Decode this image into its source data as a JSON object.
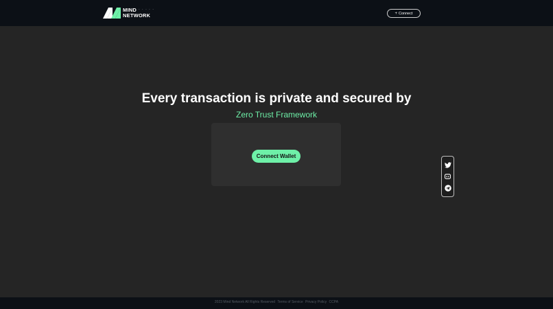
{
  "header": {
    "logo_line1": "MIND",
    "logo_line2": "NETWORK",
    "logo_dots": "· · · · ·",
    "connect_label": "Connect",
    "connect_icon": "plus-icon"
  },
  "hero": {
    "title": "Every transaction is private and secured by",
    "subtitle": "Zero Trust Framework",
    "wallet_button": "Connect Wallet"
  },
  "social": {
    "items": [
      {
        "icon": "twitter-icon"
      },
      {
        "icon": "discord-icon"
      },
      {
        "icon": "telegram-icon"
      }
    ]
  },
  "footer": {
    "copyright": "2023 Mind Network All Rights Reserved",
    "terms": "Terms of Service",
    "privacy": "Privacy Policy",
    "ccpa": "CCPA"
  },
  "colors": {
    "accent": "#6ef0a8",
    "background": "#252525",
    "bar": "#0c1016",
    "card": "#2f2f2f"
  }
}
